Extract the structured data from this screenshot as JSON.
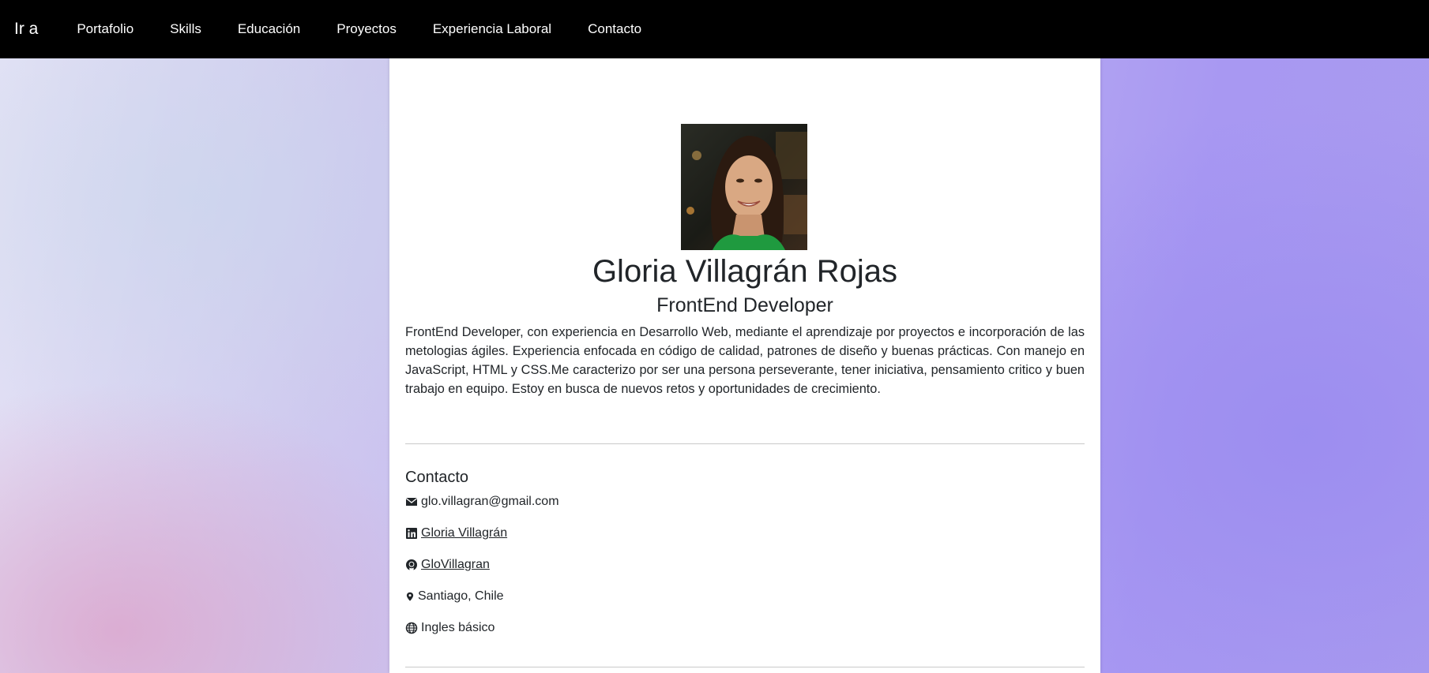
{
  "navbar": {
    "brand": "Ir a",
    "links": [
      "Portafolio",
      "Skills",
      "Educación",
      "Proyectos",
      "Experiencia Laboral",
      "Contacto"
    ]
  },
  "profile": {
    "name": "Gloria Villagrán Rojas",
    "role": "FrontEnd Developer",
    "bio": "FrontEnd Developer, con experiencia en Desarrollo Web, mediante el aprendizaje por proyectos e incorporación de las metologias ágiles. Experiencia enfocada en código de calidad, patrones de diseño y buenas prácticas. Con manejo en JavaScript, HTML y CSS.Me caracterizo por ser una persona perseverante, tener iniciativa, pensamiento critico y buen trabajo en equipo. Estoy en busca de nuevos retos y oportunidades de crecimiento."
  },
  "contact": {
    "title": "Contacto",
    "email": "glo.villagran@gmail.com",
    "linkedin": "Gloria Villagrán",
    "github": "GloVillagran",
    "location": "Santiago, Chile",
    "language": "Ingles básico"
  },
  "colors": {
    "navbar_bg": "#000000",
    "card_bg": "#ffffff",
    "text": "#212529",
    "bg_left": "#e6e4f6",
    "bg_right": "#a898f2"
  },
  "icons": [
    "envelope-icon",
    "linkedin-icon",
    "github-icon",
    "map-marker-icon",
    "globe-icon"
  ]
}
